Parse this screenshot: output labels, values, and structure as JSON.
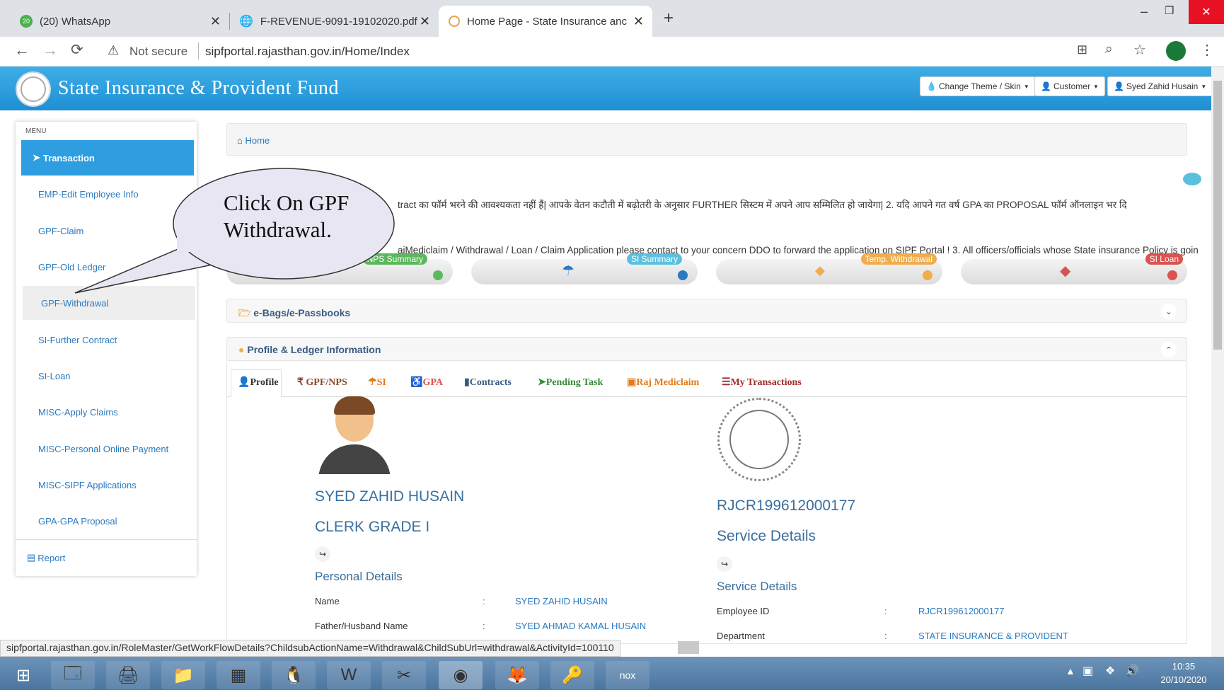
{
  "browser": {
    "tabs": [
      {
        "title": "(20) WhatsApp",
        "badge": "20"
      },
      {
        "title": "F-REVENUE-9091-19102020.pdf"
      },
      {
        "title": "Home Page - State Insurance anc"
      }
    ],
    "new_tab": "+",
    "security_label": "Not secure",
    "url": "sipfportal.rajasthan.gov.in/Home/Index",
    "status_url": "sipfportal.rajasthan.gov.in/RoleMaster/GetWorkFlowDetails?ChildsubActionName=Withdrawal&ChildSubUrl=withdrawal&ActivityId=100110"
  },
  "site": {
    "title": "State Insurance & Provident Fund",
    "buttons": {
      "theme": "Change Theme / Skin",
      "customer": "Customer",
      "user": "Syed Zahid Husain"
    }
  },
  "sidebar": {
    "heading": "MENU",
    "active": "Transaction",
    "items": [
      {
        "label": "EMP-Edit Employee Info"
      },
      {
        "label": "GPF-Claim"
      },
      {
        "label": "GPF-Old Ledger"
      },
      {
        "label": "GPF-Withdrawal"
      },
      {
        "label": "SI-Further Contract"
      },
      {
        "label": "SI-Loan"
      },
      {
        "label": "MISC-Apply Claims"
      },
      {
        "label": "MISC-Personal Online Payment"
      },
      {
        "label": "MISC-SIPF Applications"
      },
      {
        "label": "GPA-GPA Proposal"
      }
    ],
    "report": "Report"
  },
  "callout": {
    "text": "Click On GPF Withdrawal."
  },
  "breadcrumb": {
    "home": "Home"
  },
  "marquee": {
    "line1": "tract का फॉर्म भरने की आवश्यकता नहीं हैं| आपके वेतन कटौती में बढ़ोतरी के अनुसार FURTHER सिस्टम में अपने आप सम्मिलित हो जायेगा|   2. यदि आपने गत वर्ष GPA का PROPOSAL फॉर्म ऑनलाइन भर दि",
    "line2": "aiMediclaim / Withdrawal / Loan / Claim Application please contact to your concern DDO to forward the application on SIPF Portal !  3. All officers/officials whose State insurance Policy is goin"
  },
  "summary_cards": [
    {
      "label": "NPS Summary",
      "color": "#5cb85c"
    },
    {
      "label": "SI Summary",
      "color": "#5bc0de"
    },
    {
      "label": "Temp. Withdrawal",
      "color": "#f0ad4e"
    },
    {
      "label": "SI Loan",
      "color": "#d9534f"
    }
  ],
  "panels": {
    "ebags": "e-Bags/e-Passbooks",
    "profile": "Profile & Ledger Information"
  },
  "profile_tabs": [
    {
      "label": "Profile",
      "color": "#3a5b82"
    },
    {
      "label": "₹ GPF/NPS",
      "color": "#8a4a2a"
    },
    {
      "label": "SI",
      "color": "#e07b1a"
    },
    {
      "label": "GPA",
      "color": "#d9534f"
    },
    {
      "label": "Contracts",
      "color": "#3a5b82"
    },
    {
      "label": "Pending Task",
      "color": "#3a8a3a"
    },
    {
      "label": "Raj Mediclaim",
      "color": "#e07b1a"
    },
    {
      "label": "My Transactions",
      "color": "#a02a2a"
    }
  ],
  "profile": {
    "name": "SYED ZAHID HUSAIN",
    "designation": "CLERK GRADE I",
    "personal_heading": "Personal Details",
    "fields": [
      {
        "label": "Name",
        "value": "SYED ZAHID HUSAIN"
      },
      {
        "label": "Father/Husband Name",
        "value": "SYED AHMAD KAMAL HUSAIN"
      }
    ]
  },
  "service": {
    "id": "RJCR199612000177",
    "title": "Service Details",
    "heading": "Service Details",
    "fields": [
      {
        "label": "Employee ID",
        "value": "RJCR199612000177"
      },
      {
        "label": "Department",
        "value": "STATE INSURANCE & PROVIDENT"
      }
    ]
  },
  "taskbar": {
    "time": "10:35",
    "date": "20/10/2020"
  }
}
